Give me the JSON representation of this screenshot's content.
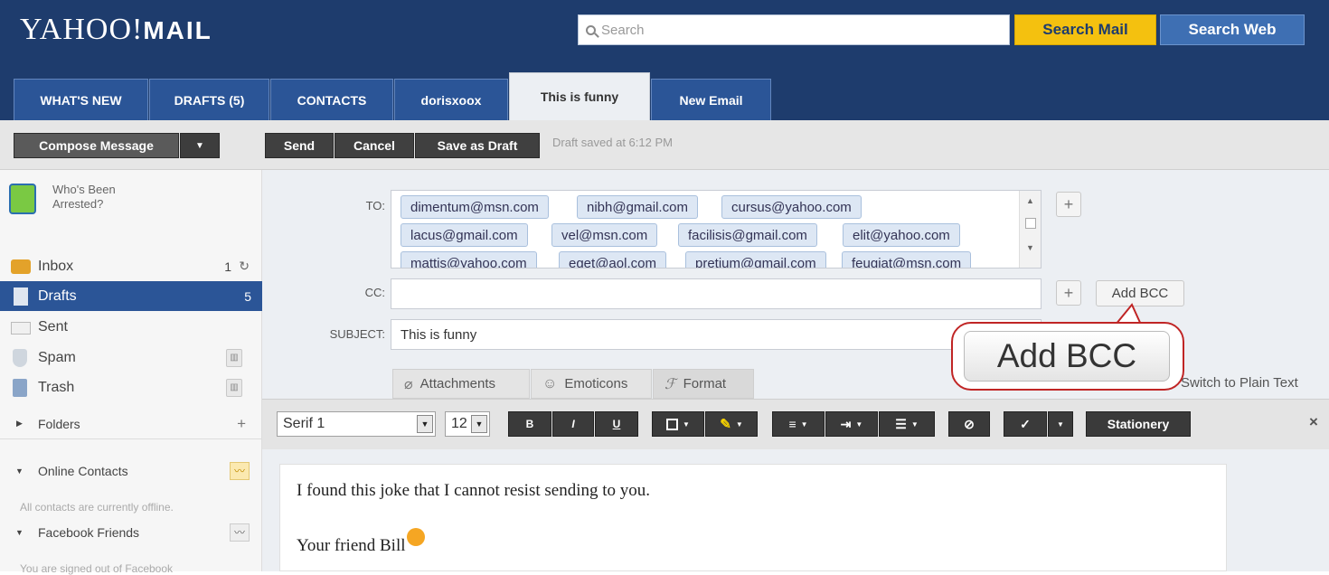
{
  "header": {
    "logo_main": "YAHOO!",
    "logo_sub": "MAIL",
    "search_placeholder": "Search",
    "search_mail_label": "Search Mail",
    "search_web_label": "Search Web"
  },
  "tabs": [
    {
      "label": "WHAT'S NEW"
    },
    {
      "label": "DRAFTS (5)"
    },
    {
      "label": "CONTACTS"
    },
    {
      "label": "dorisxoox"
    },
    {
      "label": "This is funny",
      "active": true
    },
    {
      "label": "New Email"
    }
  ],
  "toolbar": {
    "compose_label": "Compose Message",
    "send_label": "Send",
    "cancel_label": "Cancel",
    "save_draft_label": "Save as Draft",
    "status": "Draft saved at 6:12 PM"
  },
  "sidebar": {
    "promo_text": "Who's Been Arrested?",
    "items": [
      {
        "label": "Inbox",
        "count": "1"
      },
      {
        "label": "Drafts",
        "count": "5"
      },
      {
        "label": "Sent",
        "count": ""
      },
      {
        "label": "Spam",
        "count": ""
      },
      {
        "label": "Trash",
        "count": ""
      }
    ],
    "folders_label": "Folders",
    "online_contacts_label": "Online Contacts",
    "offline_text": "All contacts are currently offline.",
    "facebook_label": "Facebook Friends",
    "facebook_status": "You are signed out of Facebook"
  },
  "compose": {
    "to_label": "TO:",
    "cc_label": "CC:",
    "subject_label": "SUBJECT:",
    "recipients": [
      "dimentum@msn.com",
      "nibh@gmail.com",
      "cursus@yahoo.com",
      "lacus@gmail.com",
      "vel@msn.com",
      "facilisis@gmail.com",
      "elit@yahoo.com",
      "mattis@yahoo.com",
      "eget@aol.com",
      "pretium@gmail.com",
      "feugiat@msn.com"
    ],
    "cc_value": "",
    "subject_value": "This is funny",
    "add_bcc_label": "Add BCC",
    "callout_label": "Add BCC"
  },
  "format_tabs": {
    "attachments": "Attachments",
    "emoticons": "Emoticons",
    "format": "Format",
    "plain_text": "Switch to Plain Text"
  },
  "format_bar": {
    "font": "Serif 1",
    "size": "12",
    "bold": "B",
    "italic": "I",
    "underline": "U",
    "stationery": "Stationery",
    "close": "×"
  },
  "editor": {
    "line1": "I found this joke that I cannot resist sending to you.",
    "line2": "Your friend Bill"
  }
}
